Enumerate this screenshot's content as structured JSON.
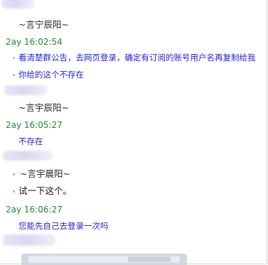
{
  "messages": [
    {
      "sender": "~言宁辰阳~",
      "timestamp": "2ay  16:02:54",
      "lines": [
        "看清楚群公告，去网页登录，确定有订阅的账号用户名再复制给我",
        "你给的这个不存在"
      ]
    },
    {
      "sender": "~言宇辰阳~",
      "timestamp": "2ay  16:05:27",
      "lines": [
        "不存在"
      ]
    },
    {
      "sender": "~言宇晨阳~",
      "lines": [
        "试一下这个。"
      ]
    },
    {
      "timestamp": "2ay  16:06:27",
      "lines": [
        "您能先自己去登录一次吗"
      ]
    }
  ],
  "colors": {
    "timestamp": "#1d8a2e",
    "message_text": "#1f1fd6",
    "plain_text": "#111111"
  }
}
